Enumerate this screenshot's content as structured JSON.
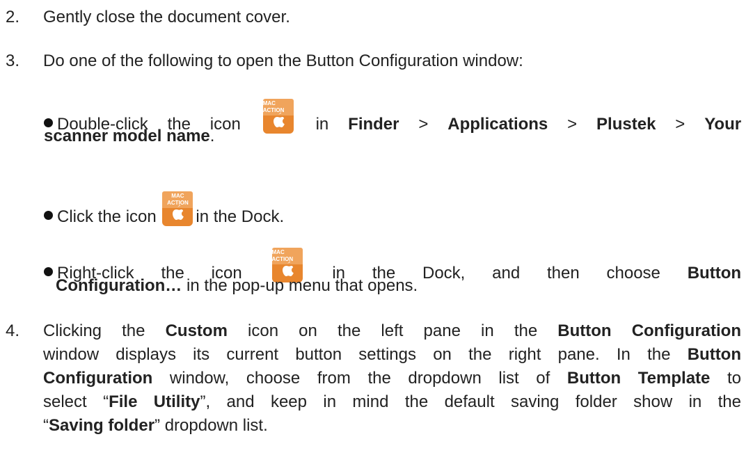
{
  "steps": {
    "s2": {
      "num": "2.",
      "text": "Gently close the document cover."
    },
    "s3": {
      "num": "3.",
      "text": "Do one of the following to open the Button Configuration window:"
    },
    "s4": {
      "num": "4.",
      "l1a": "Clicking the ",
      "l1b": "Custom",
      "l1c": " icon on the left pane in the ",
      "l1d": "Button Configuration",
      "l2a": "window displays its current button settings on the right pane. In the ",
      "l2b": "Button",
      "l3a": "Configuration",
      "l3b": " window, choose from the dropdown list of ",
      "l3c": "Button Template",
      "l3d": " to",
      "l4a": "select “",
      "l4b": "File Utility",
      "l4c": "”, and keep in mind the default saving folder show in the",
      "l5a": "“",
      "l5b": "Saving folder",
      "l5c": "” dropdown list."
    }
  },
  "bullets": {
    "b1": {
      "a": "Double-click the icon",
      "b": "in",
      "finder": "Finder",
      "gt1": ">",
      "applications": "Applications",
      "gt2": ">",
      "plustek": "Plustek",
      "gt3": ">",
      "your": "Your",
      "l2": "scanner model name",
      "l2end": "."
    },
    "b2": {
      "a": "Click the icon",
      "b": "in the Dock."
    },
    "b3": {
      "a": "Right-click the icon",
      "b": "in the Dock, and then choose",
      "c": "Button",
      "l2a": "Configuration…",
      "l2b": " in the pop-up menu that opens."
    }
  },
  "icon": {
    "name": "mac-action-icon",
    "label_top": "MAC",
    "label_bottom": "ACTION",
    "color": "#e8862e"
  }
}
